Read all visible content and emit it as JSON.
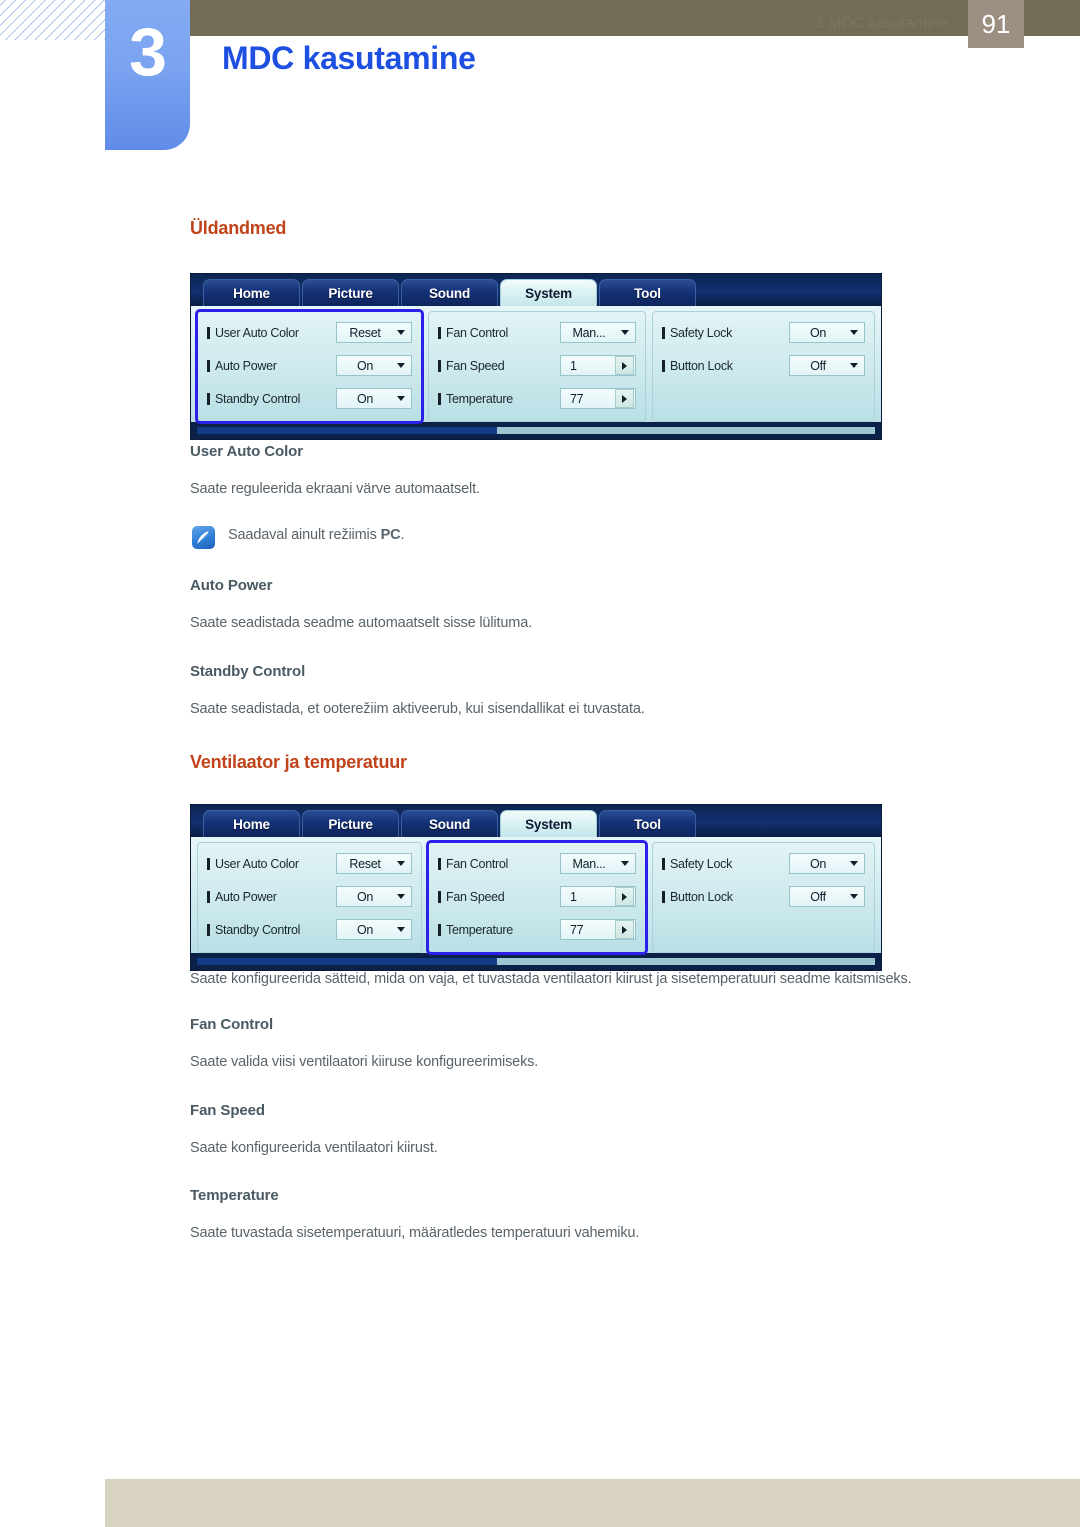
{
  "header": {
    "chapter_number": "3",
    "chapter_title": "MDC kasutamine"
  },
  "sections": [
    {
      "heading": "Üldandmed",
      "subsections": [
        {
          "title": "User Auto Color",
          "text": "Saate reguleerida ekraani värve automaatselt.",
          "note_prefix": "Saadaval ainult režiimis ",
          "note_bold": "PC",
          "note_suffix": "."
        },
        {
          "title": "Auto Power",
          "text": "Saate seadistada seadme automaatselt sisse lülituma."
        },
        {
          "title": "Standby Control",
          "text": "Saate seadistada, et ooterežiim aktiveerub, kui sisendallikat ei tuvastata."
        }
      ]
    },
    {
      "heading": "Ventilaator ja temperatuur",
      "intro": "Saate konfigureerida sätteid, mida on vaja, et tuvastada ventilaatori kiirust ja sisetemperatuuri seadme kaitsmiseks.",
      "subsections": [
        {
          "title": "Fan Control",
          "text": "Saate valida viisi ventilaatori kiiruse konfigureerimiseks."
        },
        {
          "title": "Fan Speed",
          "text": "Saate konfigureerida ventilaatori kiirust."
        },
        {
          "title": "Temperature",
          "text": "Saate tuvastada sisetemperatuuri, määratledes temperatuuri vahemiku."
        }
      ]
    }
  ],
  "mdc_panel": {
    "tabs": [
      {
        "label": "Home",
        "active": false
      },
      {
        "label": "Picture",
        "active": false
      },
      {
        "label": "Sound",
        "active": false
      },
      {
        "label": "System",
        "active": true
      },
      {
        "label": "Tool",
        "active": false
      }
    ],
    "column1": {
      "rows": [
        {
          "label": "User Auto Color",
          "value": "Reset",
          "type": "dropdown"
        },
        {
          "label": "Auto Power",
          "value": "On",
          "type": "dropdown"
        },
        {
          "label": "Standby Control",
          "value": "On",
          "type": "dropdown"
        }
      ]
    },
    "column2": {
      "rows": [
        {
          "label": "Fan Control",
          "value": "Man...",
          "type": "dropdown"
        },
        {
          "label": "Fan Speed",
          "value": "1",
          "type": "spinner"
        },
        {
          "label": "Temperature",
          "value": "77",
          "type": "spinner"
        }
      ]
    },
    "column3": {
      "rows": [
        {
          "label": "Safety Lock",
          "value": "On",
          "type": "dropdown"
        },
        {
          "label": "Button Lock",
          "value": "Off",
          "type": "dropdown"
        }
      ]
    }
  },
  "panel_highlights": {
    "first": "column1",
    "second": "column2"
  },
  "footer": {
    "text": "3 MDC kasutamine",
    "page": "91"
  },
  "colors": {
    "chapter_tab": "#7aa3f0",
    "chapter_title": "#1d4fe0",
    "header_bar": "#726b55",
    "section_heading": "#c0431a",
    "sub_heading": "#4a5a63",
    "body_text": "#58636a",
    "highlight_outline": "#2b20e8",
    "footer_bar": "#d9d3c1",
    "footer_page": "#9a8f80"
  }
}
